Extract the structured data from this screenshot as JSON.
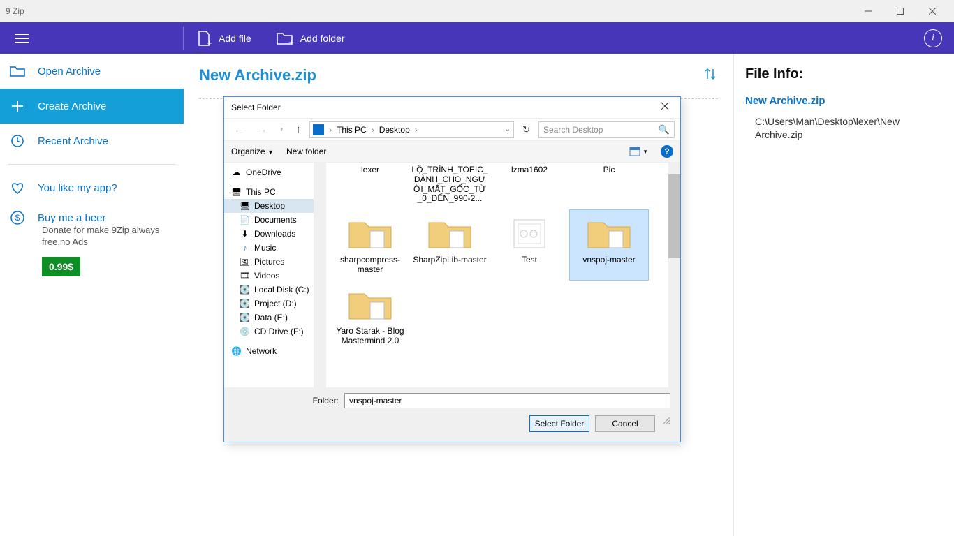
{
  "titlebar": {
    "title": "9 Zip"
  },
  "toolbar": {
    "add_file": "Add file",
    "add_folder": "Add folder"
  },
  "sidebar": {
    "open": "Open Archive",
    "create": "Create Archive",
    "recent": "Recent Archive",
    "like": "You like my app?",
    "beer": "Buy me a beer",
    "donate": "Donate for make 9Zip always free,no Ads",
    "price": "0.99$"
  },
  "content": {
    "archive_title": "New Archive.zip"
  },
  "info": {
    "heading": "File Info:",
    "name": "New Archive.zip",
    "path": "C:\\Users\\Man\\Desktop\\lexer\\New Archive.zip"
  },
  "dialog": {
    "title": "Select Folder",
    "breadcrumb": {
      "root": "This PC",
      "current": "Desktop"
    },
    "search_placeholder": "Search Desktop",
    "organize": "Organize",
    "new_folder": "New folder",
    "folder_label": "Folder:",
    "folder_value": "vnspoj-master",
    "select_btn": "Select Folder",
    "cancel_btn": "Cancel",
    "tree": {
      "onedrive": "OneDrive",
      "thispc": "This PC",
      "desktop": "Desktop",
      "documents": "Documents",
      "downloads": "Downloads",
      "music": "Music",
      "pictures": "Pictures",
      "videos": "Videos",
      "localc": "Local Disk (C:)",
      "projectd": "Project (D:)",
      "datae": "Data (E:)",
      "cdf": "CD Drive (F:)",
      "network": "Network"
    },
    "files": {
      "lexer": "lexer",
      "toeic": "LỘ_TRÌNH_TOEIC_DÀNH_CHO_NGƯỜI_MẤT_GỐC_TỪ_0_ĐẾN_990-2...",
      "lzma": "lzma1602",
      "pic": "Pic",
      "sharp": "sharpcompress-master",
      "sharpzip": "SharpZipLib-master",
      "test": "Test",
      "vnspoj": "vnspoj-master",
      "yaro": "Yaro Starak - Blog Mastermind 2.0"
    }
  }
}
